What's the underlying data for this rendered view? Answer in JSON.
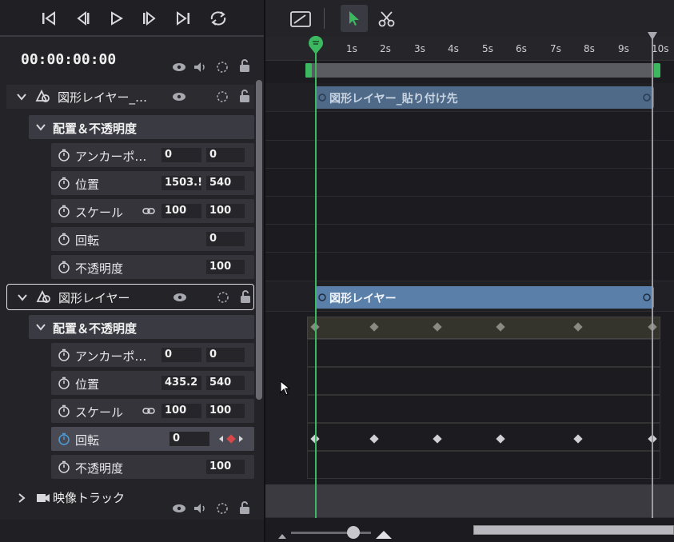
{
  "timecode": "00:00:00:00",
  "layers": [
    {
      "name": "図形レイヤー_…",
      "props": [
        {
          "label": "アンカーポ…",
          "v1": "0",
          "v2": "0"
        },
        {
          "label": "位置",
          "v1": "1503.!",
          "v2": "540"
        },
        {
          "label": "スケール",
          "v1": "100",
          "v2": "100"
        },
        {
          "label": "回転",
          "v1": "",
          "v2": "0"
        },
        {
          "label": "不透明度",
          "v1": "",
          "v2": "100"
        }
      ]
    },
    {
      "name": "図形レイヤー",
      "props": [
        {
          "label": "アンカーポ…",
          "v1": "0",
          "v2": "0"
        },
        {
          "label": "位置",
          "v1": "435.2",
          "v2": "540"
        },
        {
          "label": "スケール",
          "v1": "100",
          "v2": "100"
        },
        {
          "label": "回転",
          "v1": "0",
          "v2": ""
        },
        {
          "label": "不透明度",
          "v1": "",
          "v2": "100"
        }
      ]
    }
  ],
  "group_label": "配置＆不透明度",
  "video_track": "映像トラック",
  "ruler_ticks": [
    "1s",
    "2s",
    "3s",
    "4s",
    "5s",
    "6s",
    "7s",
    "8s",
    "9s",
    "10s"
  ],
  "clips": [
    {
      "name": "図形レイヤー_貼り付け先"
    },
    {
      "name": "図形レイヤー"
    }
  ],
  "colors": {
    "accent": "#3cb860",
    "clip": "#5a7fa8",
    "selected": "#4a9edb"
  }
}
